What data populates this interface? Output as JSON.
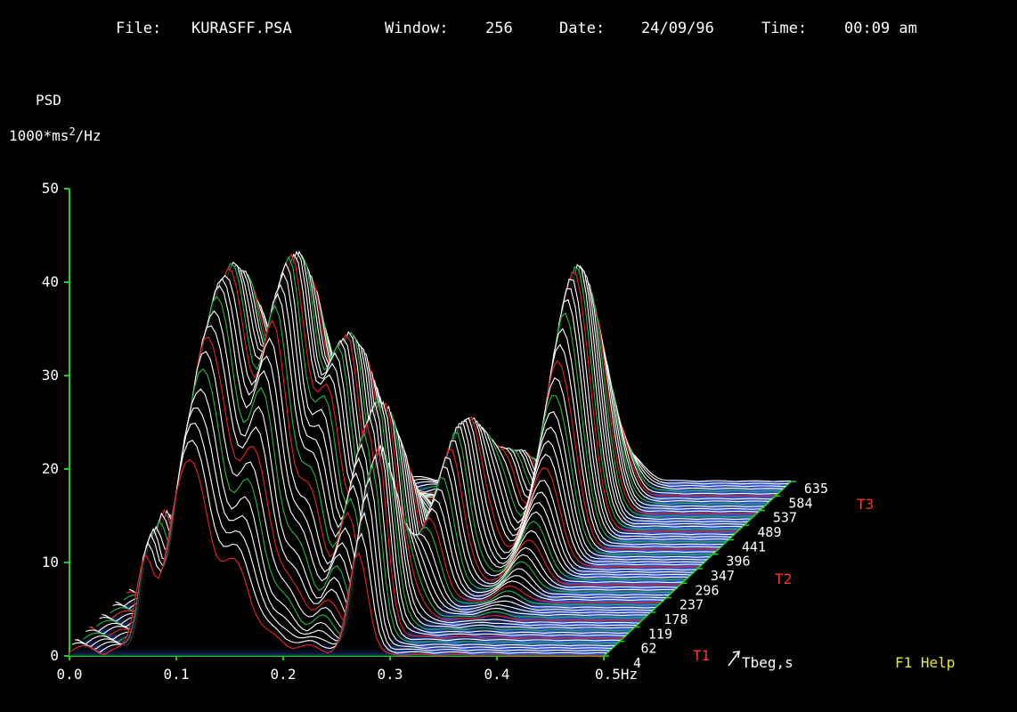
{
  "header": {
    "file_label": "File:",
    "file_name": "KURASFF.PSA",
    "window_label": "Window:",
    "window_value": "256",
    "date_label": "Date:",
    "date_value": "24/09/96",
    "time_label": "Time:",
    "time_value": "00:09 am"
  },
  "footer": {
    "help": "F1 Help"
  },
  "colors": {
    "background": "#000000",
    "axis": "#22cc22",
    "floor": "#3355cc",
    "slice_main": "#ffffff",
    "slice_red": "#ee2222",
    "slice_green": "#22bb44",
    "text": "#ffffff",
    "marker_red": "#ff3333",
    "help": "#e8e830"
  },
  "chart_data": {
    "type": "surface3d-waterfall",
    "ylabel_line1": "PSD",
    "ylabel_line2_prefix": "1000*ms",
    "ylabel_line2_sup": "2",
    "ylabel_line2_suffix": "/Hz",
    "ylim": [
      0,
      50
    ],
    "y_ticks": [
      0,
      10,
      20,
      30,
      40,
      50
    ],
    "y_tick_labels": [
      "0",
      "10",
      "20",
      "30",
      "40",
      "50"
    ],
    "xlim": [
      0,
      0.5
    ],
    "x_ticks": [
      0,
      0.1,
      0.2,
      0.3,
      0.4,
      0.5
    ],
    "x_tick_labels": [
      "0.0",
      "0.1",
      "0.2",
      "0.3",
      "0.4",
      "0.5Hz"
    ],
    "t_label": "Tbeg,s",
    "t_ticks": [
      4,
      62,
      119,
      178,
      237,
      296,
      347,
      396,
      441,
      489,
      537,
      584,
      635
    ],
    "t_tick_labels": [
      "4",
      "62",
      "119",
      "178",
      "237",
      "296",
      "347",
      "396",
      "441",
      "489",
      "537",
      "584",
      "635"
    ],
    "t_markers": [
      {
        "label": "T1",
        "t": 4
      },
      {
        "label": "T2",
        "t": 347
      },
      {
        "label": "T3",
        "t": 635
      }
    ],
    "peaks": [
      {
        "f": 0.07,
        "t": 60,
        "psd": 12,
        "wf": 0.008,
        "wt": 90
      },
      {
        "f": 0.1,
        "t": 120,
        "psd": 22,
        "wf": 0.012,
        "wt": 110
      },
      {
        "f": 0.12,
        "t": 150,
        "psd": 29,
        "wf": 0.013,
        "wt": 130
      },
      {
        "f": 0.155,
        "t": 200,
        "psd": 36,
        "wf": 0.014,
        "wt": 120
      },
      {
        "f": 0.19,
        "t": 260,
        "psd": 25,
        "wf": 0.012,
        "wt": 110
      },
      {
        "f": 0.225,
        "t": 230,
        "psd": 20,
        "wf": 0.01,
        "wt": 90
      },
      {
        "f": 0.27,
        "t": 70,
        "psd": 20,
        "wf": 0.009,
        "wt": 60
      },
      {
        "f": 0.285,
        "t": 300,
        "psd": 16,
        "wf": 0.011,
        "wt": 90
      },
      {
        "f": 0.345,
        "t": 470,
        "psd": 25,
        "wf": 0.013,
        "wt": 80
      },
      {
        "f": 0.305,
        "t": 420,
        "psd": 8,
        "wf": 0.01,
        "wt": 80
      },
      {
        "f": 0.36,
        "t": 380,
        "psd": 9,
        "wf": 0.012,
        "wt": 100
      }
    ]
  }
}
